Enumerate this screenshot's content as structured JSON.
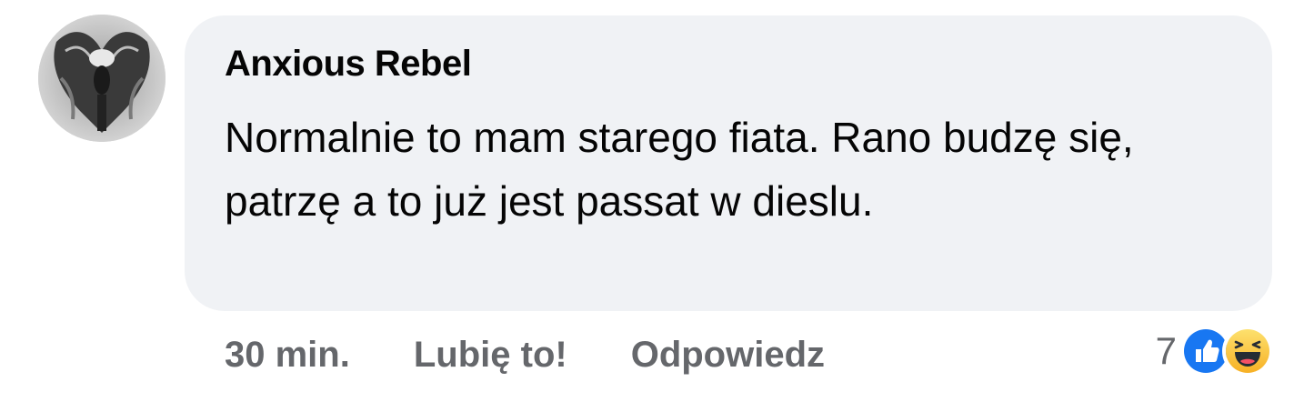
{
  "comment": {
    "author": "Anxious Rebel",
    "text": "Normalnie to mam starego fiata. Rano budzę się, patrzę a to już jest passat w dieslu.",
    "avatar_icon": "profile-photo"
  },
  "actions": {
    "time": "30 min.",
    "like_label": "Lubię to!",
    "reply_label": "Odpowiedz"
  },
  "reactions": {
    "count": "7",
    "icons": [
      "thumbs-up-icon",
      "haha-emoji-icon"
    ],
    "like_color": "#1877f2",
    "haha_color": "#f7b125"
  }
}
